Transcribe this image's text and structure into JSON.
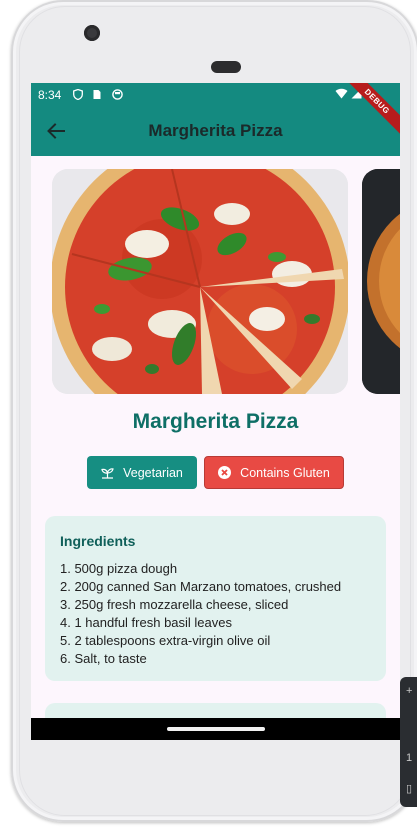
{
  "status_bar": {
    "time": "8:34"
  },
  "app_bar": {
    "title": "Margherita Pizza",
    "debug_banner": "DEBUG"
  },
  "recipe": {
    "title": "Margherita Pizza",
    "tags": [
      {
        "label": "Vegetarian",
        "icon": "sprout-icon",
        "color": "#168e82"
      },
      {
        "label": "Contains Gluten",
        "icon": "cancel-circle-icon",
        "color": "#e84a44"
      }
    ],
    "ingredients": {
      "heading": "Ingredients",
      "items": [
        "1. 500g pizza dough",
        "2. 200g canned San Marzano tomatoes, crushed",
        "3. 250g fresh mozzarella cheese, sliced",
        "4. 1 handful fresh basil leaves",
        "5. 2 tablespoons extra-virgin olive oil",
        "6. Salt, to taste"
      ]
    }
  },
  "colors": {
    "primary": "#148a80",
    "title": "#0e6f66",
    "danger": "#e84a44",
    "card": "#e2f2ef"
  }
}
